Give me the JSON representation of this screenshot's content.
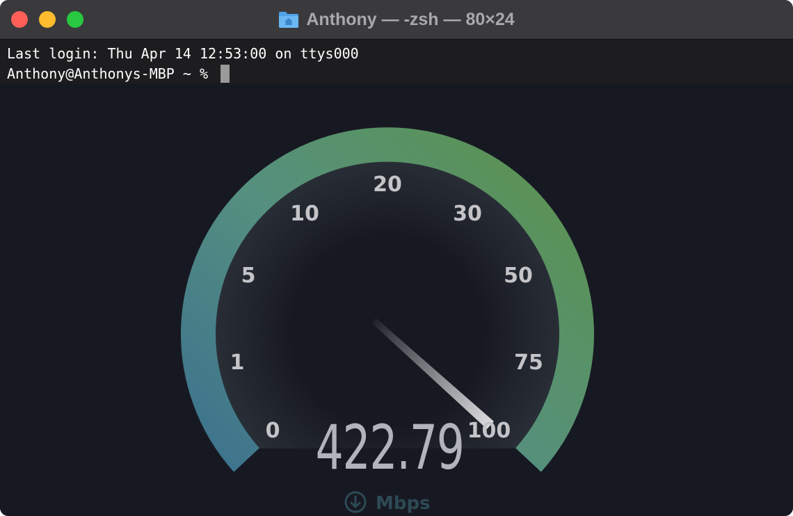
{
  "window": {
    "title": "Anthony — -zsh — 80×24",
    "title_icon": "home-folder-icon"
  },
  "terminal": {
    "lines": [
      "Last login: Thu Apr 14 12:53:00 on ttys000",
      "Anthony@Anthonys-MBP ~ % "
    ]
  },
  "speedometer": {
    "scale_labels": [
      "0",
      "1",
      "5",
      "10",
      "20",
      "30",
      "50",
      "75",
      "100"
    ],
    "value": "422.79",
    "unit": "Mbps",
    "unit_icon": "download-arrow-icon",
    "colors": {
      "arc_start": "#3a6f90",
      "arc_mid": "#55907f",
      "arc_end": "#5b9350",
      "background": "#171922"
    }
  }
}
